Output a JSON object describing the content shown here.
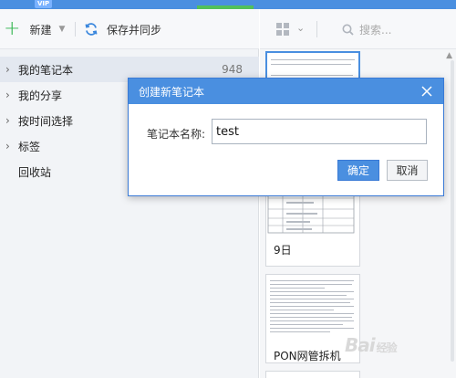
{
  "app": {
    "vip_badge": "VIP",
    "accent_color": "#4a8fe0",
    "green_color": "#2db34a"
  },
  "toolbar": {
    "new_label": "新建",
    "sync_label": "保存并同步"
  },
  "nav": {
    "items": [
      {
        "label": "我的笔记本",
        "count": "948"
      },
      {
        "label": "我的分享"
      },
      {
        "label": "按时间选择"
      },
      {
        "label": "标签"
      },
      {
        "label": "回收站"
      }
    ]
  },
  "right": {
    "search_placeholder": "搜索...",
    "cards": [
      {
        "title": ""
      },
      {
        "title": "9日"
      },
      {
        "title": "PON网管拆机"
      }
    ]
  },
  "dialog": {
    "title": "创建新笔记本",
    "field_label": "笔记本名称:",
    "field_value": "test",
    "ok_label": "确定",
    "cancel_label": "取消"
  },
  "watermark": {
    "text": "Bai",
    "suffix": "经验"
  }
}
